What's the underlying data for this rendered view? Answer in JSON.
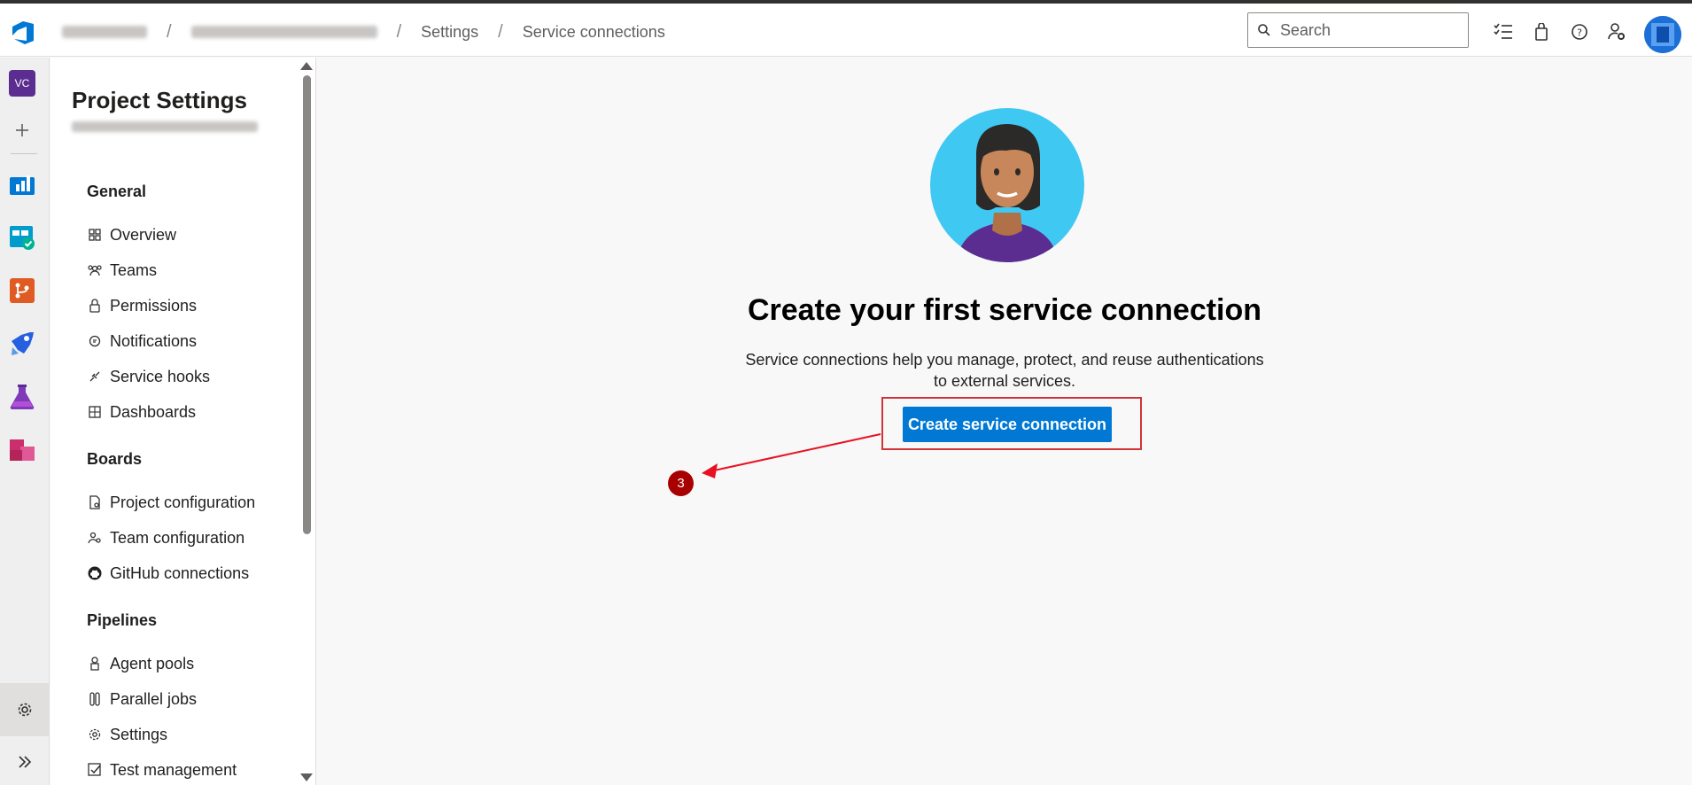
{
  "breadcrumb": {
    "items": [
      "Settings",
      "Service connections"
    ]
  },
  "search": {
    "placeholder": "Search"
  },
  "rail": {
    "project_initials": "VC"
  },
  "sidebar": {
    "title": "Project Settings",
    "groups": [
      {
        "label": "General",
        "items": [
          "Overview",
          "Teams",
          "Permissions",
          "Notifications",
          "Service hooks",
          "Dashboards"
        ]
      },
      {
        "label": "Boards",
        "items": [
          "Project configuration",
          "Team configuration",
          "GitHub connections"
        ]
      },
      {
        "label": "Pipelines",
        "items": [
          "Agent pools",
          "Parallel jobs",
          "Settings",
          "Test management"
        ]
      }
    ]
  },
  "main": {
    "headline": "Create your first service connection",
    "description": "Service connections help you manage, protect, and reuse authentications to external services.",
    "cta_label": "Create service connection",
    "step_badge": "3"
  },
  "colors": {
    "accent": "#0078d4",
    "highlight": "#d13438",
    "badge": "#a80000"
  }
}
